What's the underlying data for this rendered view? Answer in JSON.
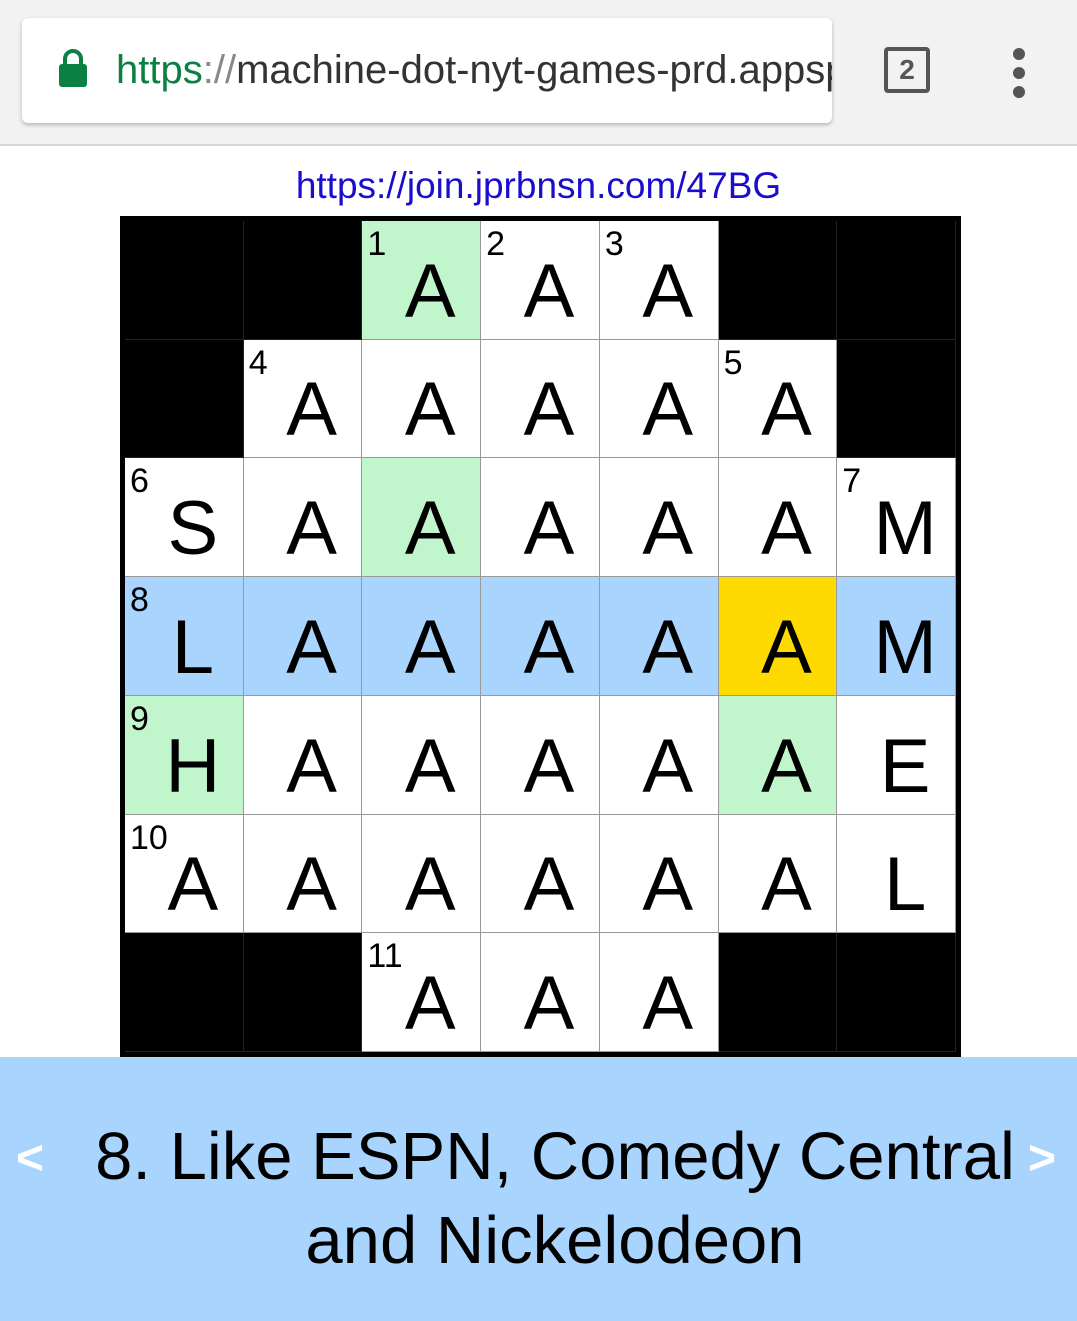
{
  "browser": {
    "url_scheme": "https",
    "url_sep": "://",
    "url_rest": "machine-dot-nyt-games-prd.appspot.com",
    "tab_count": "2"
  },
  "link_text": "https://join.jprbnsn.com/47BG",
  "grid": {
    "rows": [
      [
        {
          "t": "block"
        },
        {
          "t": "block"
        },
        {
          "t": "related",
          "num": "1",
          "ch": "A"
        },
        {
          "num": "2",
          "ch": "A"
        },
        {
          "num": "3",
          "ch": "A"
        },
        {
          "t": "block"
        },
        {
          "t": "block"
        }
      ],
      [
        {
          "t": "block"
        },
        {
          "num": "4",
          "ch": "A"
        },
        {
          "ch": "A"
        },
        {
          "ch": "A"
        },
        {
          "ch": "A"
        },
        {
          "num": "5",
          "ch": "A"
        },
        {
          "t": "block"
        }
      ],
      [
        {
          "num": "6",
          "ch": "S"
        },
        {
          "ch": "A"
        },
        {
          "t": "related",
          "ch": "A"
        },
        {
          "ch": "A"
        },
        {
          "ch": "A"
        },
        {
          "ch": "A"
        },
        {
          "num": "7",
          "ch": "M"
        }
      ],
      [
        {
          "t": "word",
          "num": "8",
          "ch": "L"
        },
        {
          "t": "word",
          "ch": "A"
        },
        {
          "t": "word",
          "ch": "A"
        },
        {
          "t": "word",
          "ch": "A"
        },
        {
          "t": "word",
          "ch": "A"
        },
        {
          "t": "active",
          "ch": "A"
        },
        {
          "t": "word",
          "ch": "M"
        }
      ],
      [
        {
          "t": "related",
          "num": "9",
          "ch": "H"
        },
        {
          "ch": "A"
        },
        {
          "ch": "A"
        },
        {
          "ch": "A"
        },
        {
          "ch": "A"
        },
        {
          "t": "related",
          "ch": "A"
        },
        {
          "ch": "E"
        }
      ],
      [
        {
          "num": "10",
          "ch": "A"
        },
        {
          "ch": "A"
        },
        {
          "ch": "A"
        },
        {
          "ch": "A"
        },
        {
          "ch": "A"
        },
        {
          "ch": "A"
        },
        {
          "ch": "L"
        }
      ],
      [
        {
          "t": "block"
        },
        {
          "t": "block"
        },
        {
          "num": "11",
          "ch": "A"
        },
        {
          "ch": "A"
        },
        {
          "ch": "A"
        },
        {
          "t": "block"
        },
        {
          "t": "block"
        }
      ]
    ]
  },
  "clue": {
    "text": "8. Like ESPN, Comedy Central and Nickelodeon",
    "prev_label": "<",
    "next_label": ">"
  }
}
